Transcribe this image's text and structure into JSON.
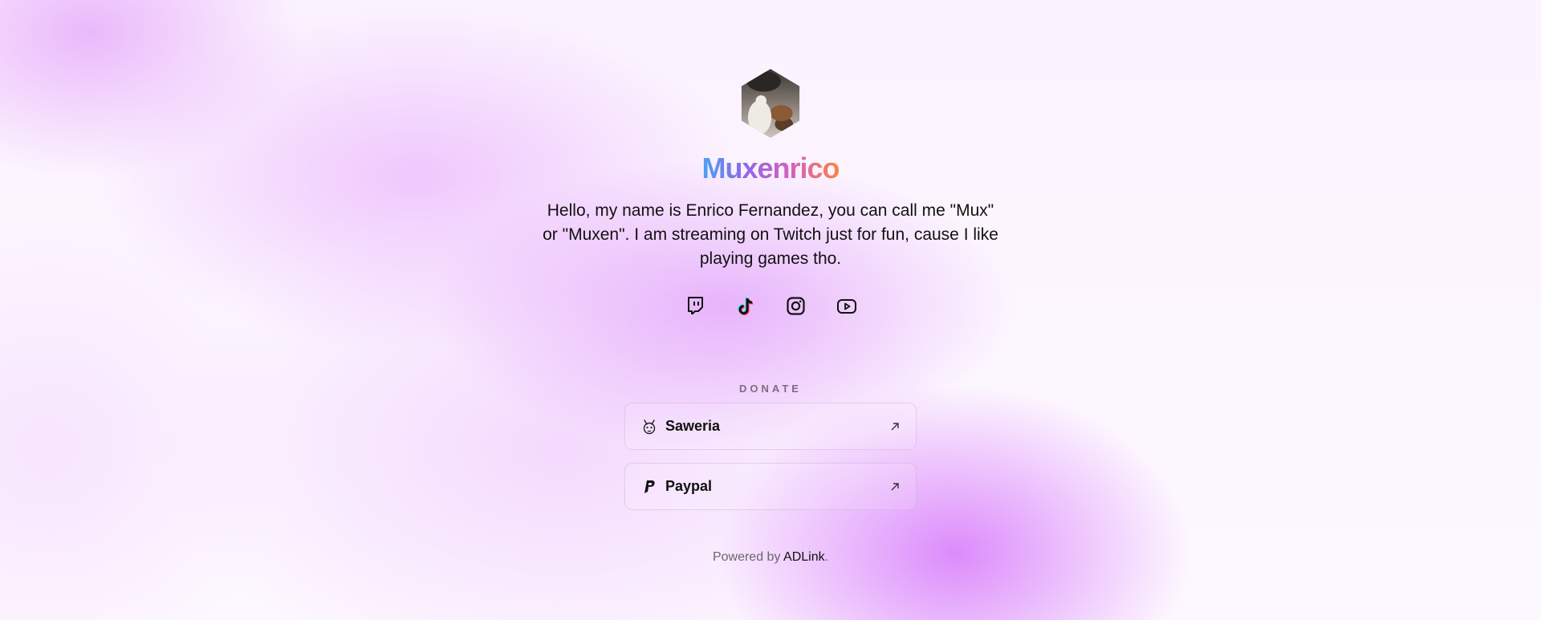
{
  "profile": {
    "name": "Muxenrico",
    "bio": "Hello, my name is Enrico Fernandez, you can call me \"Mux\" or \"Muxen\". I am streaming on Twitch just for fun, cause I like playing games tho."
  },
  "socials": [
    {
      "icon": "twitch-icon"
    },
    {
      "icon": "tiktok-icon"
    },
    {
      "icon": "instagram-icon"
    },
    {
      "icon": "youtube-icon"
    }
  ],
  "donate": {
    "heading": "DONATE",
    "links": [
      {
        "label": "Saweria",
        "icon": "saweria-icon"
      },
      {
        "label": "Paypal",
        "icon": "paypal-icon"
      }
    ]
  },
  "footer": {
    "prefix": "Powered by ",
    "brand": "ADLink",
    "suffix": "."
  },
  "colors": {
    "name_gradient": [
      "#4aa2f2",
      "#8a6ae8",
      "#d75fbf",
      "#f88646"
    ],
    "background_accent": "#d678fa"
  }
}
